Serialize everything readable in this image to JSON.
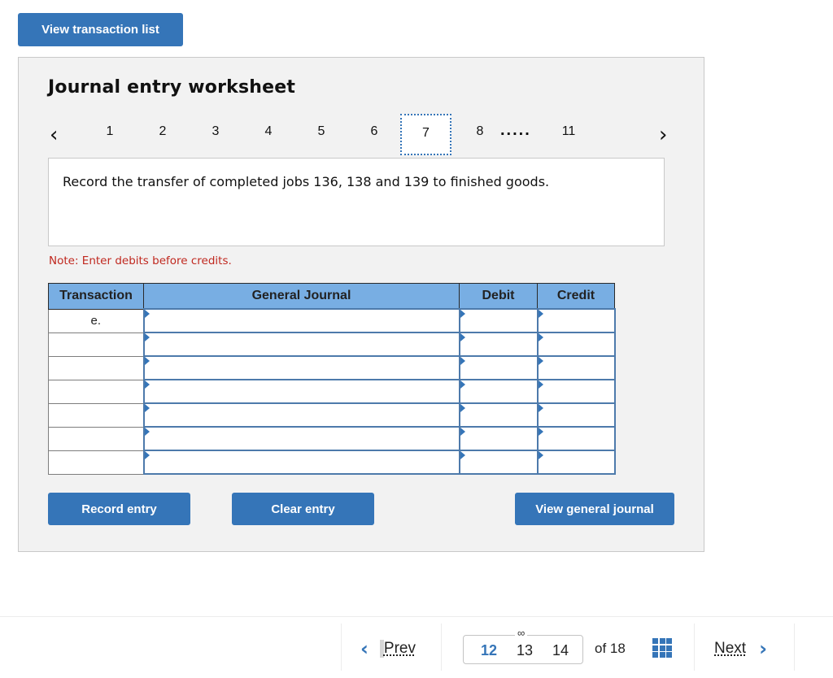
{
  "top": {
    "view_transaction_list": "View transaction list"
  },
  "worksheet": {
    "title": "Journal entry worksheet",
    "pager": {
      "prev_icon": "chevron-left-icon",
      "next_icon": "chevron-right-icon",
      "pages": [
        "1",
        "2",
        "3",
        "4",
        "5",
        "6",
        "7",
        "8"
      ],
      "active_page": "7",
      "ellipsis": ".....",
      "last_page": "11"
    },
    "description": "Record the transfer of completed jobs 136, 138 and 139 to finished goods.",
    "note": "Note: Enter debits before credits.",
    "table": {
      "headers": {
        "transaction": "Transaction",
        "general_journal": "General Journal",
        "debit": "Debit",
        "credit": "Credit"
      },
      "rows": [
        {
          "transaction": "e.",
          "general_journal": "",
          "debit": "",
          "credit": ""
        },
        {
          "transaction": "",
          "general_journal": "",
          "debit": "",
          "credit": ""
        },
        {
          "transaction": "",
          "general_journal": "",
          "debit": "",
          "credit": ""
        },
        {
          "transaction": "",
          "general_journal": "",
          "debit": "",
          "credit": ""
        },
        {
          "transaction": "",
          "general_journal": "",
          "debit": "",
          "credit": ""
        },
        {
          "transaction": "",
          "general_journal": "",
          "debit": "",
          "credit": ""
        },
        {
          "transaction": "",
          "general_journal": "",
          "debit": "",
          "credit": ""
        }
      ]
    },
    "buttons": {
      "record": "Record entry",
      "clear": "Clear entry",
      "view_general_journal": "View general journal"
    }
  },
  "footer": {
    "prev": "Prev",
    "next": "Next",
    "pages": [
      "12",
      "13",
      "14"
    ],
    "current_page": "12",
    "of_label": "of 18",
    "link_icon": "link-icon",
    "grid_icon": "grid-icon"
  },
  "colors": {
    "accent": "#3575b8",
    "header_bg": "#78aee3",
    "note": "#c0281f",
    "panel_bg": "#f2f2f2"
  }
}
